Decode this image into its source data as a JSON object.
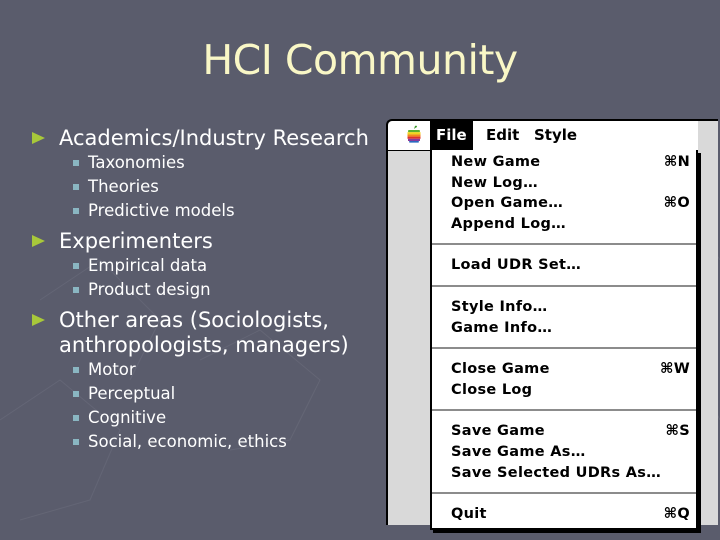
{
  "slide": {
    "title": "HCI Community",
    "bullets": [
      {
        "label": "Academics/Industry Research",
        "children": [
          "Taxonomies",
          "Theories",
          "Predictive models"
        ]
      },
      {
        "label": "Experimenters",
        "children": [
          "Empirical data",
          "Product design"
        ]
      },
      {
        "label_line1": "Other areas (Sociologists,",
        "label_line2": "anthropologists, managers)",
        "children": [
          "Motor",
          "Perceptual",
          "Cognitive",
          "Social, economic, ethics"
        ]
      }
    ]
  },
  "menu": {
    "apple_icon": "apple-rainbow-icon",
    "menubar": [
      "File",
      "Edit",
      "Style"
    ],
    "active_menu": "File",
    "groups": [
      [
        {
          "label": "New Game",
          "shortcut": "⌘N"
        },
        {
          "label": "New Log…",
          "shortcut": ""
        },
        {
          "label": "Open Game…",
          "shortcut": "⌘O"
        },
        {
          "label": "Append Log…",
          "shortcut": ""
        }
      ],
      [
        {
          "label": "Load UDR Set…",
          "shortcut": ""
        }
      ],
      [
        {
          "label": "Style Info…",
          "shortcut": ""
        },
        {
          "label": "Game Info…",
          "shortcut": ""
        }
      ],
      [
        {
          "label": "Close Game",
          "shortcut": "⌘W"
        },
        {
          "label": "Close Log",
          "shortcut": ""
        }
      ],
      [
        {
          "label": "Save Game",
          "shortcut": "⌘S"
        },
        {
          "label": "Save Game As…",
          "shortcut": ""
        },
        {
          "label": "Save Selected UDRs As…",
          "shortcut": ""
        }
      ],
      [
        {
          "label": "Quit",
          "shortcut": "⌘Q"
        }
      ]
    ]
  },
  "colors": {
    "background": "#5a5c6c",
    "title": "#f9f7c6",
    "level1_bullet": "#a8c83a",
    "level2_bullet": "#8ab6c2"
  }
}
